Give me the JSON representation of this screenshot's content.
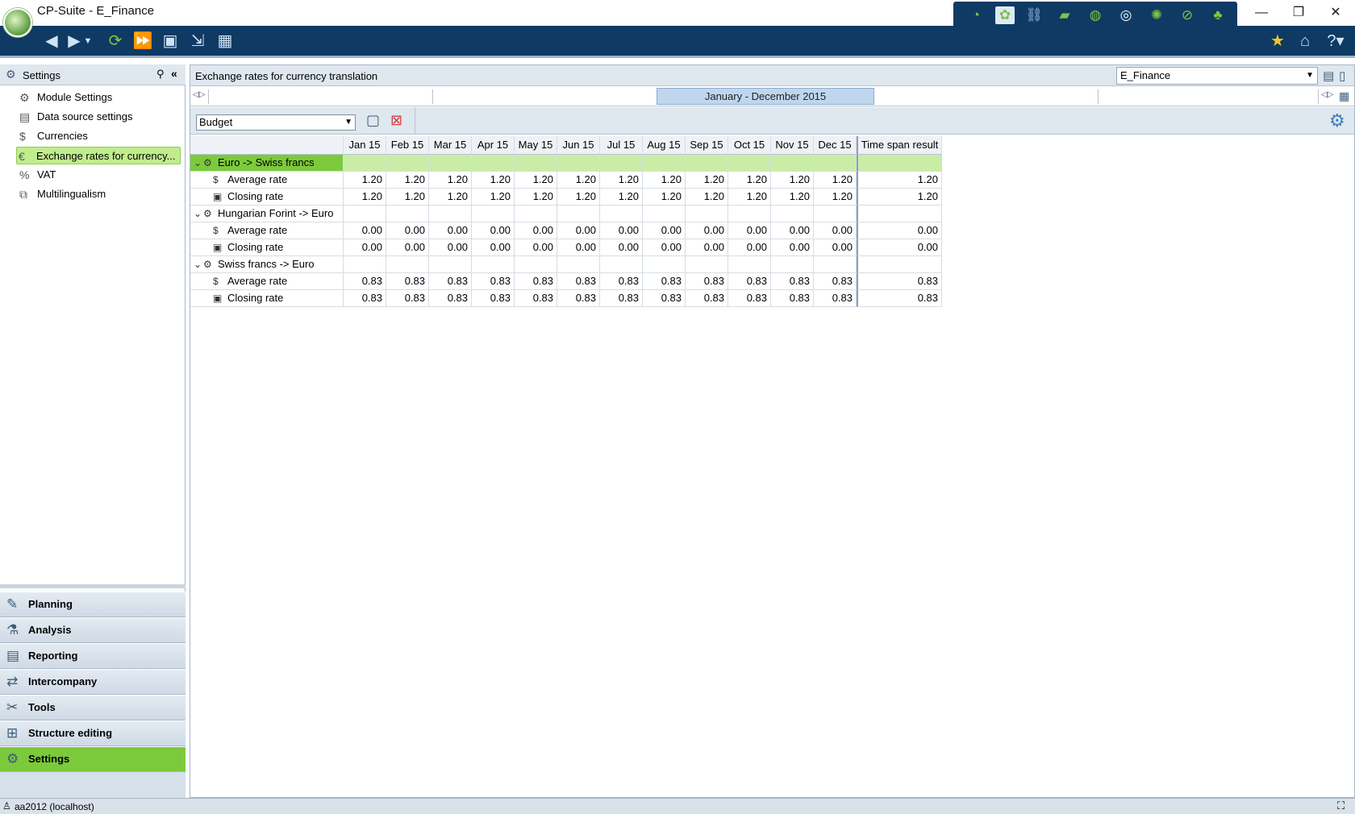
{
  "window": {
    "title": "CP-Suite - E_Finance",
    "minimize": "—",
    "restore": "❐",
    "close": "✕"
  },
  "module_icons": [
    "dashboard-icon",
    "planning-module-icon",
    "link-icon",
    "money-icon",
    "globe-icon",
    "lifebuoy-icon",
    "gears-icon",
    "no-entry-icon",
    "org-chart-icon"
  ],
  "left_panel": {
    "title": "Settings",
    "tree": [
      {
        "label": "Module Settings",
        "icon": "gear-icon"
      },
      {
        "label": "Data source settings",
        "icon": "data-source-icon"
      },
      {
        "label": "Currencies",
        "icon": "currency-icon"
      },
      {
        "label": "Exchange rates for currency...",
        "icon": "exchange-rate-icon"
      },
      {
        "label": "VAT",
        "icon": "vat-icon"
      },
      {
        "label": "Multilingualism",
        "icon": "language-icon"
      }
    ],
    "nav": [
      {
        "label": "Planning",
        "icon": "planning-icon"
      },
      {
        "label": "Analysis",
        "icon": "analysis-icon"
      },
      {
        "label": "Reporting",
        "icon": "reporting-icon"
      },
      {
        "label": "Intercompany",
        "icon": "intercompany-icon"
      },
      {
        "label": "Tools",
        "icon": "tools-icon"
      },
      {
        "label": "Structure editing",
        "icon": "structure-icon"
      },
      {
        "label": "Settings",
        "icon": "settings-icon"
      }
    ]
  },
  "main": {
    "title": "Exchange rates for currency translation",
    "workspace": "E_Finance",
    "timespan": "January - December 2015",
    "version": "Budget"
  },
  "grid": {
    "columns": [
      "Jan 15",
      "Feb 15",
      "Mar 15",
      "Apr 15",
      "May 15",
      "Jun 15",
      "Jul 15",
      "Aug 15",
      "Sep 15",
      "Oct 15",
      "Nov 15",
      "Dec 15",
      "Time span result"
    ],
    "groups": [
      {
        "label": "Euro -> Swiss francs",
        "rows": [
          {
            "label": "Average rate",
            "values": [
              "1.20",
              "1.20",
              "1.20",
              "1.20",
              "1.20",
              "1.20",
              "1.20",
              "1.20",
              "1.20",
              "1.20",
              "1.20",
              "1.20",
              "1.20"
            ]
          },
          {
            "label": "Closing rate",
            "values": [
              "1.20",
              "1.20",
              "1.20",
              "1.20",
              "1.20",
              "1.20",
              "1.20",
              "1.20",
              "1.20",
              "1.20",
              "1.20",
              "1.20",
              "1.20"
            ]
          }
        ]
      },
      {
        "label": "Hungarian Forint -> Euro",
        "rows": [
          {
            "label": "Average rate",
            "values": [
              "0.00",
              "0.00",
              "0.00",
              "0.00",
              "0.00",
              "0.00",
              "0.00",
              "0.00",
              "0.00",
              "0.00",
              "0.00",
              "0.00",
              "0.00"
            ]
          },
          {
            "label": "Closing rate",
            "values": [
              "0.00",
              "0.00",
              "0.00",
              "0.00",
              "0.00",
              "0.00",
              "0.00",
              "0.00",
              "0.00",
              "0.00",
              "0.00",
              "0.00",
              "0.00"
            ]
          }
        ]
      },
      {
        "label": "Swiss francs -> Euro",
        "rows": [
          {
            "label": "Average rate",
            "values": [
              "0.83",
              "0.83",
              "0.83",
              "0.83",
              "0.83",
              "0.83",
              "0.83",
              "0.83",
              "0.83",
              "0.83",
              "0.83",
              "0.83",
              "0.83"
            ]
          },
          {
            "label": "Closing rate",
            "values": [
              "0.83",
              "0.83",
              "0.83",
              "0.83",
              "0.83",
              "0.83",
              "0.83",
              "0.83",
              "0.83",
              "0.83",
              "0.83",
              "0.83",
              "0.83"
            ]
          }
        ]
      }
    ]
  },
  "status": {
    "connection": "aa2012 (localhost)"
  },
  "colors": {
    "toolbar": "#0e3a63",
    "accent_green": "#7cca3c",
    "selected_green": "#c1ec8c"
  }
}
